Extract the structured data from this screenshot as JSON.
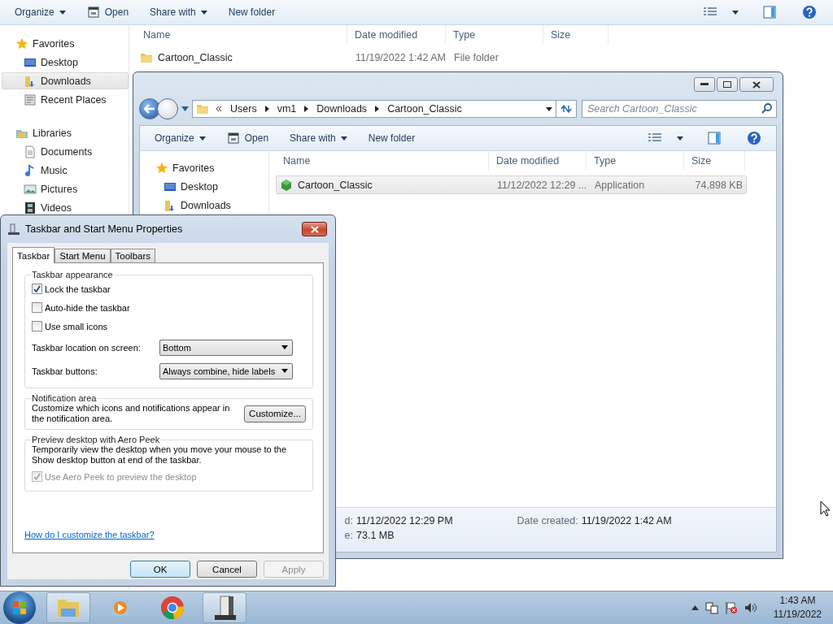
{
  "back_window": {
    "toolbar": [
      {
        "label": "Organize",
        "kind": "menu"
      },
      {
        "label": "Open",
        "kind": "icon"
      },
      {
        "label": "Share with",
        "kind": "menu"
      },
      {
        "label": "New folder",
        "kind": "plain"
      }
    ],
    "nav": [
      {
        "label": "Favorites",
        "selected": false,
        "children": [
          {
            "label": "Desktop",
            "selected": false
          },
          {
            "label": "Downloads",
            "selected": true
          },
          {
            "label": "Recent Places",
            "selected": false
          }
        ]
      },
      {
        "label": "Libraries",
        "selected": false,
        "children": [
          {
            "label": "Documents",
            "selected": false
          },
          {
            "label": "Music",
            "selected": false
          },
          {
            "label": "Pictures",
            "selected": false
          },
          {
            "label": "Videos",
            "selected": false
          }
        ]
      }
    ],
    "columns": [
      "Name",
      "Date modified",
      "Type",
      "Size"
    ],
    "rows": [
      {
        "name": "Cartoon_Classic",
        "date": "11/19/2022 1:42 AM",
        "type": "File folder",
        "selected": false
      }
    ]
  },
  "front_window": {
    "address": [
      "Users",
      "vm1",
      "Downloads",
      "Cartoon_Classic"
    ],
    "search": {
      "placeholder": "Search Cartoon_Classic"
    },
    "toolbar": [
      {
        "label": "Organize",
        "kind": "menu"
      },
      {
        "label": "Open",
        "kind": "icon"
      },
      {
        "label": "Share with",
        "kind": "menu"
      },
      {
        "label": "New folder",
        "kind": "plain"
      }
    ],
    "nav": [
      {
        "label": "Favorites",
        "selected": false,
        "children": [
          {
            "label": "Desktop",
            "selected": false
          },
          {
            "label": "Downloads",
            "selected": false
          }
        ]
      }
    ],
    "columns": [
      "Name",
      "Date modified",
      "Type",
      "Size"
    ],
    "rows": [
      {
        "name": "Cartoon_Classic",
        "date": "11/12/2022 12:29 ...",
        "type": "Application",
        "size": "74,898 KB",
        "selected": true
      }
    ],
    "details": [
      {
        "label": "d:",
        "value": "11/12/2022 12:29 PM"
      },
      {
        "label": "Date created:",
        "value": "11/19/2022 1:42 AM"
      },
      {
        "label": "e:",
        "value": "73.1 MB"
      }
    ]
  },
  "dialog": {
    "title": "Taskbar and Start Menu Properties",
    "tabs": [
      {
        "label": "Taskbar",
        "selected": true
      },
      {
        "label": "Start Menu",
        "selected": false
      },
      {
        "label": "Toolbars",
        "selected": false
      }
    ],
    "groups": [
      {
        "title": "Taskbar appearance",
        "items": [
          {
            "kind": "checkbox",
            "label": "Lock the taskbar",
            "checked": true,
            "disabled": false
          },
          {
            "kind": "checkbox",
            "label": "Auto-hide the taskbar",
            "checked": false,
            "disabled": false
          },
          {
            "kind": "checkbox",
            "label": "Use small icons",
            "checked": false,
            "disabled": false
          },
          {
            "kind": "dropdown",
            "label": "Taskbar location on screen:",
            "value": "Bottom"
          },
          {
            "kind": "dropdown",
            "label": "Taskbar buttons:",
            "value": "Always combine, hide labels"
          }
        ]
      },
      {
        "title": "Notification area",
        "items": [
          {
            "kind": "text_button",
            "text": "Customize which icons and notifications appear in the notification area.",
            "button": "Customize..."
          }
        ]
      },
      {
        "title": "Preview desktop with Aero Peek",
        "items": [
          {
            "kind": "text",
            "text": "Temporarily view the desktop when you move your mouse to the Show desktop button at end of the taskbar."
          },
          {
            "kind": "checkbox",
            "label": "Use Aero Peek to preview the desktop",
            "checked": true,
            "disabled": true
          }
        ]
      }
    ],
    "link": "How do I customize the taskbar?",
    "buttons": [
      {
        "label": "OK",
        "kind": "default"
      },
      {
        "label": "Cancel",
        "kind": "normal"
      },
      {
        "label": "Apply",
        "kind": "disabled"
      }
    ]
  },
  "taskbar": {
    "apps": [
      {
        "active": true
      },
      {
        "active": false
      },
      {
        "active": false
      },
      {
        "active": true
      }
    ],
    "time": "1:43 AM",
    "date": "11/19/2022"
  }
}
